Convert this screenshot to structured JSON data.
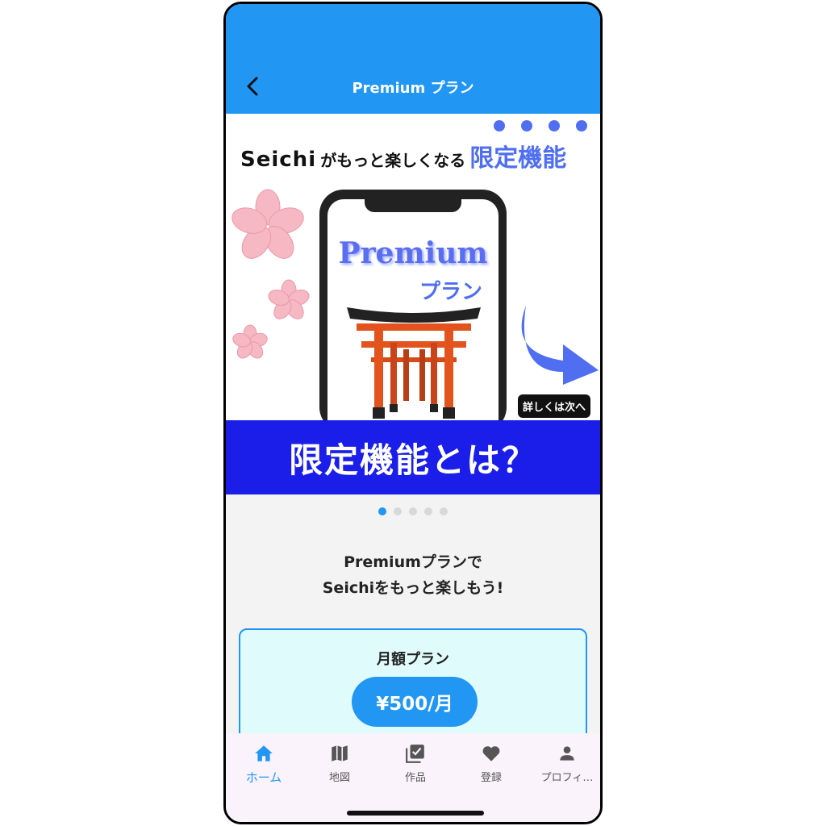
{
  "appbar": {
    "title": "Premium プラン"
  },
  "banner": {
    "brand": "Seichi",
    "headline_mid": "がもっと楽しくなる",
    "headline_feature": "限定機能",
    "art_title": "Premium",
    "art_subtitle": "プラン",
    "detail_button": "詳しくは次へ",
    "band_text": "限定機能とは？"
  },
  "pager": {
    "count": 5,
    "active": 1
  },
  "promo": {
    "line1": "Premiumプランで",
    "line2": "Seichiをもっと楽しもう!"
  },
  "plan": {
    "title": "月額プラン",
    "price": "¥500/月"
  },
  "nav": {
    "items": [
      {
        "label": "ホーム",
        "icon": "home-icon",
        "active": true
      },
      {
        "label": "地図",
        "icon": "map-icon",
        "active": false
      },
      {
        "label": "作品",
        "icon": "checklist-icon",
        "active": false
      },
      {
        "label": "登録",
        "icon": "heart-icon",
        "active": false
      },
      {
        "label": "プロフィ…",
        "icon": "person-icon",
        "active": false
      }
    ]
  },
  "colors": {
    "primary": "#2196f3",
    "band": "#1a1ee8",
    "accent": "#4f6ef0",
    "card_bg": "#e0fbfb"
  }
}
